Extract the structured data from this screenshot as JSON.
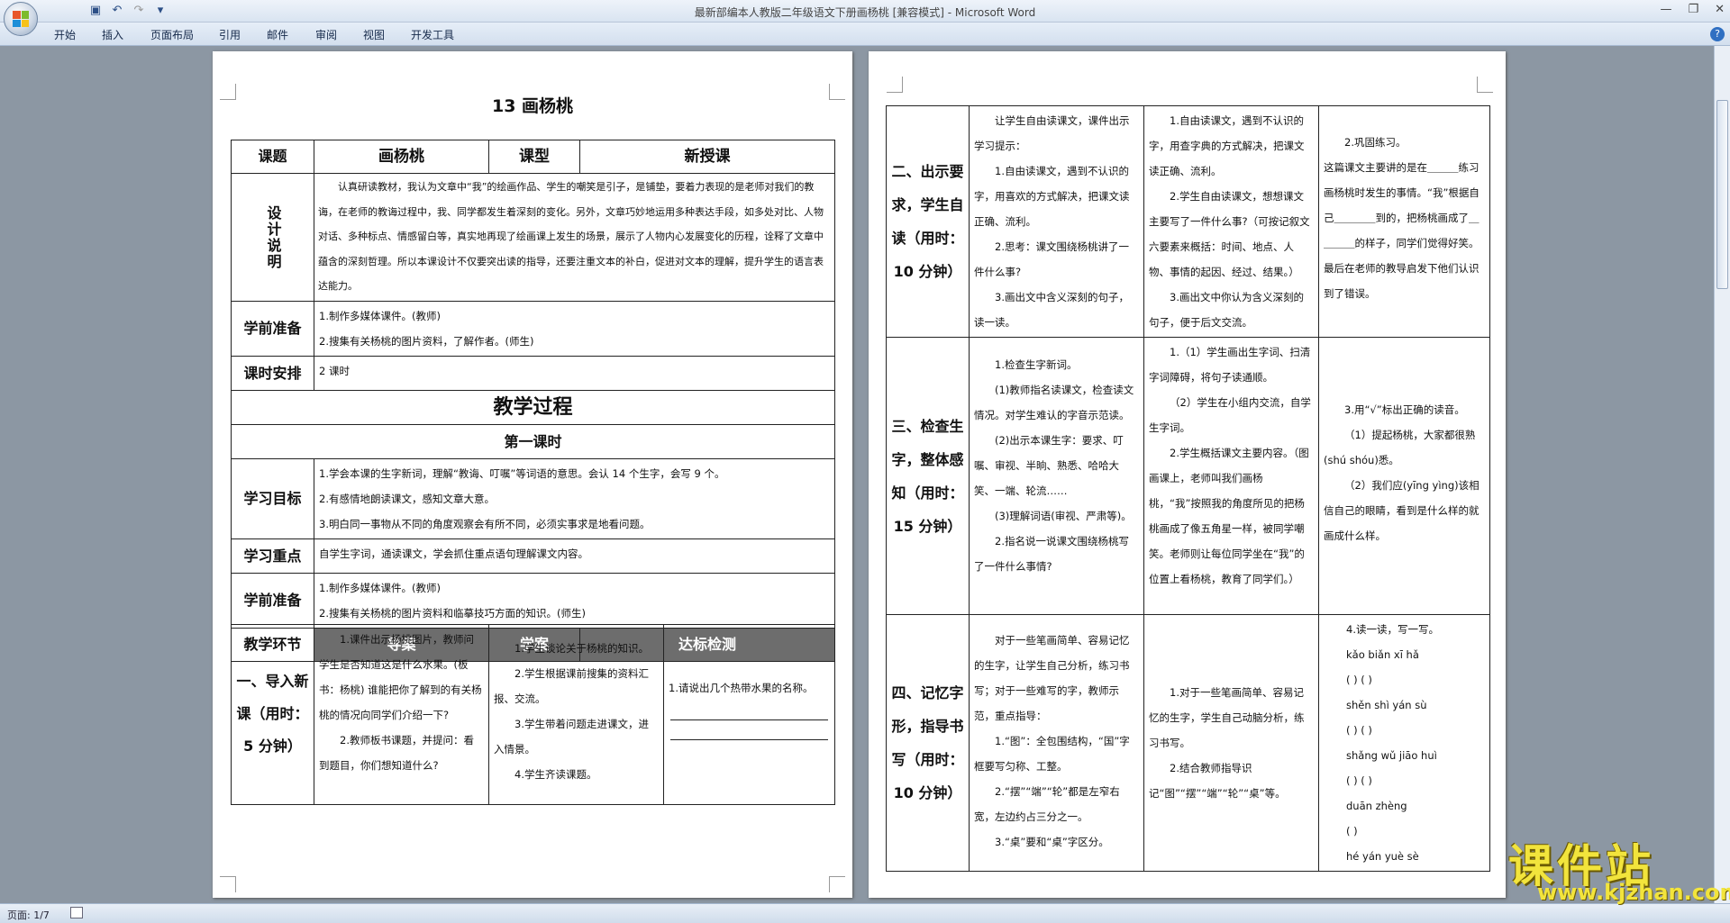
{
  "window": {
    "title": "最新部编本人教版二年级语文下册画杨桃 [兼容模式] - Microsoft Word"
  },
  "menu": {
    "tabs": [
      "开始",
      "插入",
      "页面布局",
      "引用",
      "邮件",
      "审阅",
      "视图",
      "开发工具"
    ]
  },
  "status": {
    "page": "页面: 1/7"
  },
  "watermark": {
    "big": "课件站",
    "url": "www.kjzhan.com"
  },
  "doc": {
    "title": "13  画杨桃",
    "topic_label": "课题",
    "topic": "画杨桃",
    "type_label": "课型",
    "type": "新授课",
    "design_label": "设计说明",
    "design_text": "认真研读教材，我认为文章中“我”的绘画作品、学生的嘲笑是引子，是铺垫，要着力表现的是老师对我们的教诲，在老师的教诲过程中，我、同学都发生着深刻的变化。另外，文章巧妙地运用多种表达手段，如多处对比、人物对话、多种标点、情感留白等，真实地再现了绘画课上发生的场景，展示了人物内心发展变化的历程，诠释了文章中蕴含的深刻哲理。所以本课设计不仅要突出读的指导，还要注重文本的补白，促进对文本的理解，提升学生的语言表达能力。",
    "prep_label": "学前准备",
    "prep": [
      "1.制作多媒体课件。(教师)",
      "2.搜集有关杨桃的图片资料，了解作者。(师生)"
    ],
    "hours_label": "课时安排",
    "hours": "2 课时",
    "process": "教学过程",
    "lesson1": "第一课时",
    "goals_label": "学习目标",
    "goals": [
      "1.学会本课的生字新词，理解“教诲、叮嘱”等词语的意思。会认 14 个生字，会写 9 个。",
      "2.有感情地朗读课文，感知文章大意。",
      "3.明白同一事物从不同的角度观察会有所不同，必须实事求是地看问题。"
    ],
    "key_label": "学习重点",
    "key": "自学生字词，通读课文，学会抓住重点语句理解课文内容。",
    "prep2_label": "学前准备",
    "prep2": [
      "1.制作多媒体课件。(教师)",
      "2.搜集有关杨桃的图片资料和临摹技巧方面的知识。(师生)"
    ],
    "cols": {
      "c0": "教学环节",
      "c1": "导案",
      "c2": "学案",
      "c3": "达标检测"
    },
    "s1": {
      "label": "一、导入新课（用时：5 分钟）",
      "guide": [
        "1.课件出示杨桃图片，教师问学生是否知道这是什么水果。(板书：杨桃) 谁能把你了解到的有关杨桃的情况向同学们介绍一下?",
        "2.教师板书课题，并提问：看到题目，你们想知道什么?"
      ],
      "study": [
        "1.学生谈论关于杨桃的知识。",
        "2.学生根据课前搜集的资料汇报、交流。",
        "3.学生带着问题走进课文，进入情景。",
        "4.学生齐读课题。"
      ],
      "check": "1.请说出几个热带水果的名称。"
    },
    "s2": {
      "label": "二、出示要求，学生自读（用时：10 分钟）",
      "guide": [
        "让学生自由读课文，课件出示学习提示：",
        "1.自由读课文，遇到不认识的字，用喜欢的方式解决，把课文读正确、流利。",
        "2.思考：课文围绕杨桃讲了一件什么事?",
        "3.画出文中含义深刻的句子，读一读。"
      ],
      "study": [
        "1.自由读课文，遇到不认识的字，用查字典的方式解决，把课文读正确、流利。",
        "2.学生自由读课文，想想课文主要写了一件什么事?（可按记叙文六要素来概括：时间、地点、人物、事情的起因、经过、结果。）",
        "3.画出文中你认为含义深刻的句子，便于后文交流。"
      ],
      "check": [
        "2.巩固练习。",
        "这篇课文主要讲的是在＿＿＿练习画杨桃时发生的事情。“我”根据自己＿＿＿＿到的，把杨桃画成了＿＿＿＿的样子，同学们觉得好笑。最后在老师的教导启发下他们认识到了错误。"
      ]
    },
    "s3": {
      "label": "三、检查生字，整体感知（用时：15 分钟）",
      "guide": [
        "1.检查生字新词。",
        "(1)教师指名读课文，检查读文情况。对学生难认的字音示范读。",
        "(2)出示本课生字：要求、叮嘱、审视、半晌、熟悉、哈哈大笑、一端、轮流……",
        "(3)理解词语(审视、严肃等)。",
        "2.指名说一说课文围绕杨桃写了一件什么事情?"
      ],
      "study": [
        "1.（1）学生画出生字词、扫清字词障碍，将句子读通顺。",
        "（2）学生在小组内交流，自学生字词。",
        "2.学生概括课文主要内容。（图画课上，老师叫我们画杨桃，“我”按照我的角度所见的把杨桃画成了像五角星一样，被同学嘲笑。老师则让每位同学坐在“我”的位置上看杨桃，教育了同学们。）"
      ],
      "check": [
        "3.用“√”标出正确的读音。",
        "（1）提起杨桃，大家都很熟(shú  shóu)悉。",
        "（2）我们应(yīng  yìng)该相信自己的眼睛，看到是什么样的就画成什么样。"
      ]
    },
    "s4": {
      "label": "四、记忆字形，指导书写（用时：10 分钟）",
      "guide": [
        "对于一些笔画简单、容易记忆的生字，让学生自己分析，练习书写；对于一些难写的字，教师示范，重点指导：",
        "1.“图”：全包围结构，“国”字框要写匀称、工整。",
        "2.“摆”“端”“轮”都是左窄右宽，左边约占三分之一。",
        "3.“桌”要和“桌”字区分。"
      ],
      "study": [
        "1.对于一些笔画简单、容易记忆的生字，学生自己动脑分析，练习书写。",
        "2.结合教师指导识记“图”“摆”“端”“轮”“桌”等。"
      ],
      "check": [
        "4.读一读，写一写。",
        "kǎo  biǎn    xī  hǎ",
        "(      )    (      )",
        "shěn shì      yán  sù",
        "(      )    (      )",
        "shǎng  wǔ    jiāo  huì",
        "(      )    (      )",
        "duān  zhèng",
        "(      )",
        "hé  yán  yuè  sè"
      ]
    }
  }
}
